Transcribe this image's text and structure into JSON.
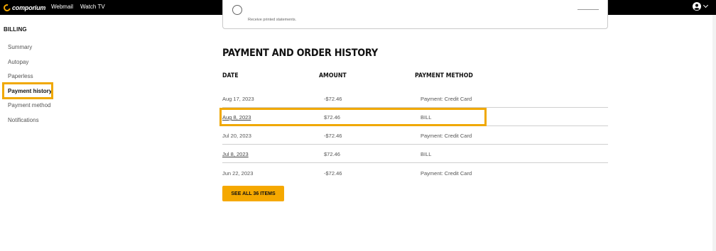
{
  "topbar": {
    "logo_text": "comporium",
    "nav": [
      "Webmail",
      "Watch TV"
    ],
    "user_icon": "user-circle-icon",
    "menu_icon": "chevron-down-icon"
  },
  "sidebar": {
    "heading": "BILLING",
    "items": [
      {
        "label": "Summary"
      },
      {
        "label": "Autopay"
      },
      {
        "label": "Paperless"
      },
      {
        "label": "Payment history"
      },
      {
        "label": "Payment method"
      },
      {
        "label": "Notifications"
      }
    ],
    "active": "Payment history"
  },
  "card": {
    "option_text": "Receive printed statements."
  },
  "history": {
    "title": "PAYMENT AND ORDER HISTORY",
    "headers": {
      "date": "DATE",
      "amount": "AMOUNT",
      "method": "PAYMENT METHOD"
    },
    "rows": [
      {
        "date": "Aug 17, 2023",
        "amount": "-$72.46",
        "method": "Payment: Credit Card"
      },
      {
        "date": "Aug 8, 2023",
        "amount": "$72.46",
        "method": "BILL"
      },
      {
        "date": "Jul 20, 2023",
        "amount": "-$72.46",
        "method": "Payment: Credit Card"
      },
      {
        "date": "Jul 8, 2023",
        "amount": "$72.46",
        "method": "BILL"
      },
      {
        "date": "Jun 22, 2023",
        "amount": "-$72.46",
        "method": "Payment: Credit Card"
      }
    ],
    "see_all_label": "SEE ALL 36 ITEMS"
  },
  "colors": {
    "accent": "#f5a800",
    "highlight": "#f0a800",
    "topbar": "#000000"
  }
}
